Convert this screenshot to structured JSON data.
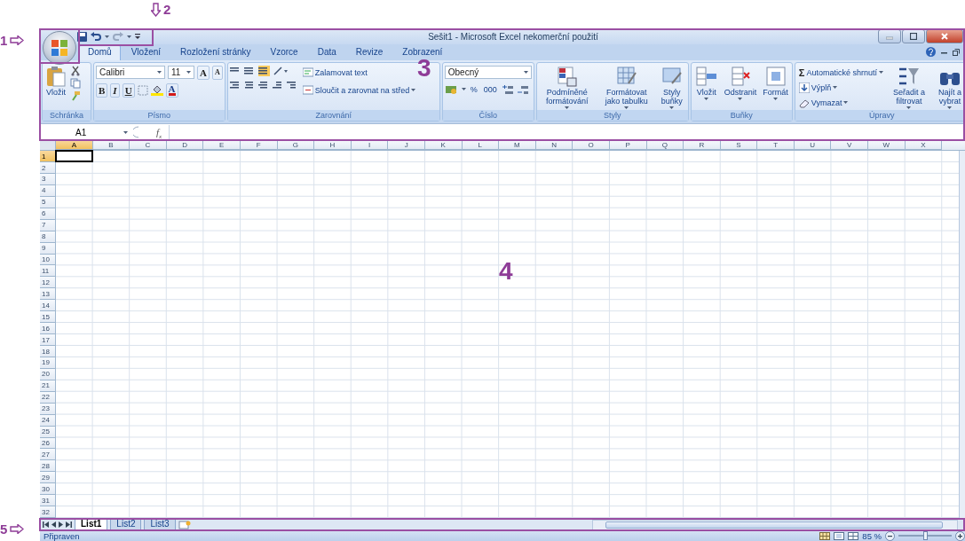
{
  "annotations": [
    {
      "label": "1"
    },
    {
      "label": "2"
    },
    {
      "label": "3"
    },
    {
      "label": "4"
    },
    {
      "label": "5"
    }
  ],
  "window": {
    "title": "Sešit1 - Microsoft Excel nekomerční použití"
  },
  "tabs": [
    {
      "label": "Domů",
      "selected": true
    },
    {
      "label": "Vložení",
      "selected": false
    },
    {
      "label": "Rozložení stránky",
      "selected": false
    },
    {
      "label": "Vzorce",
      "selected": false
    },
    {
      "label": "Data",
      "selected": false
    },
    {
      "label": "Revize",
      "selected": false
    },
    {
      "label": "Zobrazení",
      "selected": false
    }
  ],
  "ribbon": {
    "groups": [
      {
        "kind": "clipboard",
        "label": "Schránka",
        "paste": "Vložit"
      },
      {
        "kind": "font",
        "label": "Písmo",
        "font": "Calibri",
        "size": "11",
        "grow": "A",
        "shrink": "A",
        "bold": "B",
        "italic": "I",
        "underline": "U",
        "font_color": "A"
      },
      {
        "kind": "alignment",
        "label": "Zarovnání",
        "wrap": "Zalamovat text",
        "merge": "Sloučit a zarovnat na střed"
      },
      {
        "kind": "number",
        "label": "Číslo",
        "format": "Obecný",
        "percent": "%",
        "thousands": "000"
      },
      {
        "kind": "styles",
        "label": "Styly",
        "buttons": [
          "Podmíněné formátování",
          "Formátovat jako tabulku",
          "Styly buňky"
        ]
      },
      {
        "kind": "cells",
        "label": "Buňky",
        "buttons": [
          "Vložit",
          "Odstranit",
          "Formát"
        ]
      },
      {
        "kind": "editing",
        "label": "Úpravy",
        "sum_sign": "Σ",
        "sum": "Automatické shrnutí",
        "fill": "Výplň",
        "clear": "Vymazat",
        "buttons": [
          "Seřadit a filtrovat",
          "Najít a vybrat"
        ]
      }
    ]
  },
  "formula_bar": {
    "name_box": "A1",
    "fx": "f$_{x}$"
  },
  "grid": {
    "columns": [
      {
        "label": "A",
        "selected": true
      },
      {
        "label": "B",
        "selected": false
      },
      {
        "label": "C",
        "selected": false
      },
      {
        "label": "D",
        "selected": false
      },
      {
        "label": "E",
        "selected": false
      },
      {
        "label": "F",
        "selected": false
      },
      {
        "label": "G",
        "selected": false
      },
      {
        "label": "H",
        "selected": false
      },
      {
        "label": "I",
        "selected": false
      },
      {
        "label": "J",
        "selected": false
      },
      {
        "label": "K",
        "selected": false
      },
      {
        "label": "L",
        "selected": false
      },
      {
        "label": "M",
        "selected": false
      },
      {
        "label": "N",
        "selected": false
      },
      {
        "label": "O",
        "selected": false
      },
      {
        "label": "P",
        "selected": false
      },
      {
        "label": "Q",
        "selected": false
      },
      {
        "label": "R",
        "selected": false
      },
      {
        "label": "S",
        "selected": false
      },
      {
        "label": "T",
        "selected": false
      },
      {
        "label": "U",
        "selected": false
      },
      {
        "label": "V",
        "selected": false
      },
      {
        "label": "W",
        "selected": false
      },
      {
        "label": "X",
        "selected": false
      }
    ],
    "rows": [
      {
        "label": "1",
        "selected": true
      },
      {
        "label": "2",
        "selected": false
      },
      {
        "label": "3",
        "selected": false
      },
      {
        "label": "4",
        "selected": false
      },
      {
        "label": "5",
        "selected": false
      },
      {
        "label": "6",
        "selected": false
      },
      {
        "label": "7",
        "selected": false
      },
      {
        "label": "8",
        "selected": false
      },
      {
        "label": "9",
        "selected": false
      },
      {
        "label": "10",
        "selected": false
      },
      {
        "label": "11",
        "selected": false
      },
      {
        "label": "12",
        "selected": false
      },
      {
        "label": "13",
        "selected": false
      },
      {
        "label": "14",
        "selected": false
      },
      {
        "label": "15",
        "selected": false
      },
      {
        "label": "16",
        "selected": false
      },
      {
        "label": "17",
        "selected": false
      },
      {
        "label": "18",
        "selected": false
      },
      {
        "label": "19",
        "selected": false
      },
      {
        "label": "20",
        "selected": false
      },
      {
        "label": "21",
        "selected": false
      },
      {
        "label": "22",
        "selected": false
      },
      {
        "label": "23",
        "selected": false
      },
      {
        "label": "24",
        "selected": false
      },
      {
        "label": "25",
        "selected": false
      },
      {
        "label": "26",
        "selected": false
      },
      {
        "label": "27",
        "selected": false
      },
      {
        "label": "28",
        "selected": false
      },
      {
        "label": "29",
        "selected": false
      },
      {
        "label": "30",
        "selected": false
      },
      {
        "label": "31",
        "selected": false
      },
      {
        "label": "32",
        "selected": false
      }
    ]
  },
  "sheet_tabs": [
    {
      "label": "List1",
      "selected": true
    },
    {
      "label": "List2",
      "selected": false
    },
    {
      "label": "List3",
      "selected": false
    }
  ],
  "status_bar": {
    "status": "Připraven",
    "zoom": "85 %",
    "zoom_level": {
      "level": 0.5
    }
  }
}
